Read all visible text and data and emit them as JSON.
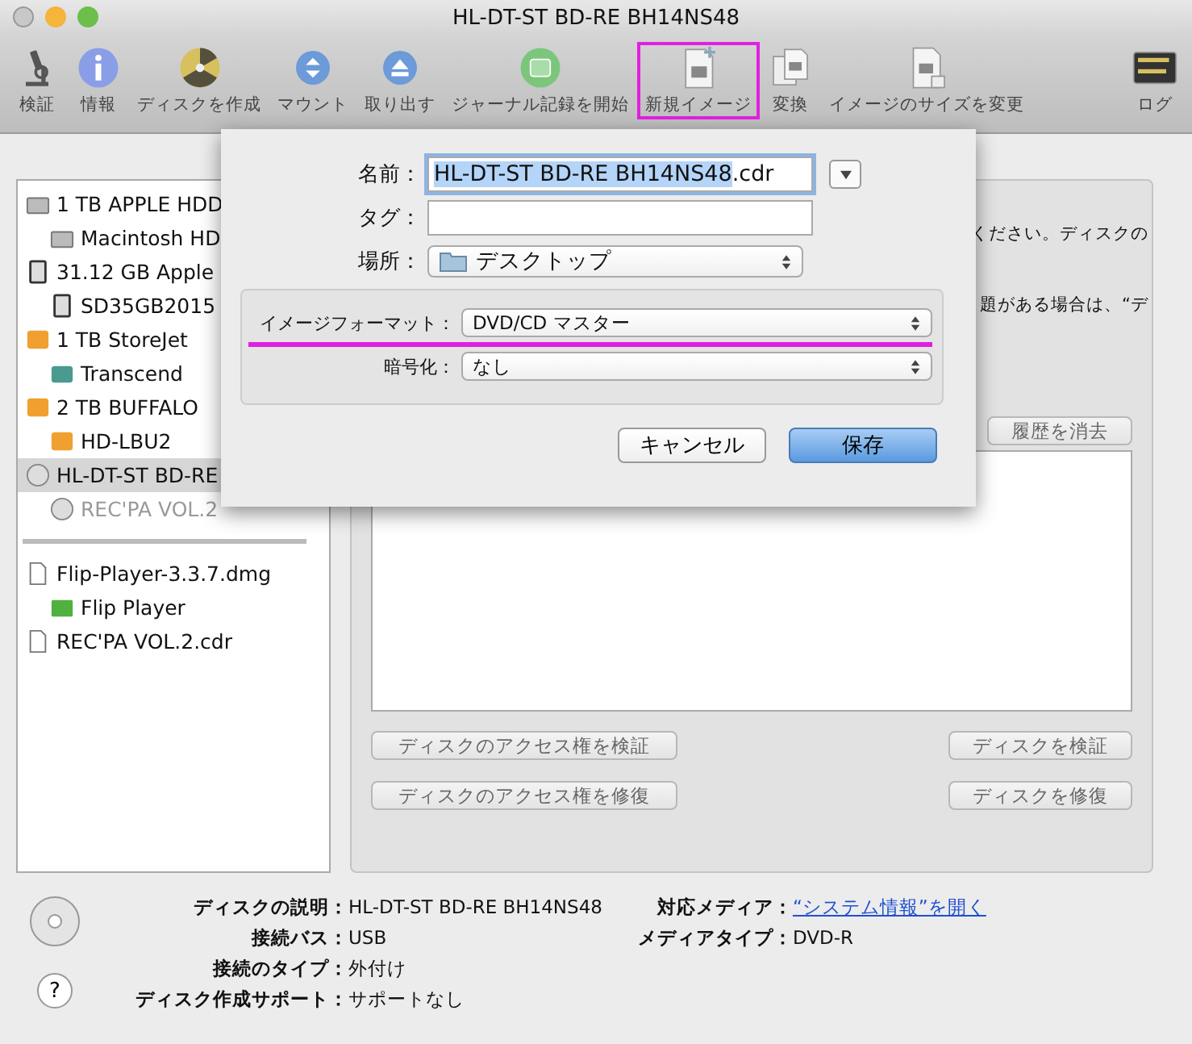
{
  "window": {
    "title": "HL-DT-ST BD-RE BH14NS48"
  },
  "toolbar": [
    {
      "kind": "microscope",
      "label": "検証",
      "highlighted": false
    },
    {
      "kind": "info",
      "label": "情報",
      "highlighted": false
    },
    {
      "kind": "burn",
      "label": "ディスクを作成",
      "highlighted": false
    },
    {
      "kind": "mount",
      "label": "マウント",
      "highlighted": false
    },
    {
      "kind": "eject",
      "label": "取り出す",
      "highlighted": false
    },
    {
      "kind": "journal",
      "label": "ジャーナル記録を開始",
      "highlighted": false
    },
    {
      "kind": "newimage",
      "label": "新規イメージ",
      "highlighted": true
    },
    {
      "kind": "convert",
      "label": "変換",
      "highlighted": false
    },
    {
      "kind": "resize",
      "label": "イメージのサイズを変更",
      "highlighted": false
    },
    {
      "kind": "log",
      "label": "ログ",
      "highlighted": false
    }
  ],
  "sidebar": {
    "groups": [
      [
        {
          "kind": "hdd",
          "name": "1 TB APPLE HDD",
          "selected": false,
          "disabled": false,
          "children": [
            {
              "kind": "hdd",
              "name": "Macintosh HD",
              "selected": false,
              "disabled": false
            }
          ]
        },
        {
          "kind": "sd",
          "name": "31.12 GB Apple",
          "selected": false,
          "disabled": false,
          "children": [
            {
              "kind": "sd",
              "name": "SD35GB2015",
              "selected": false,
              "disabled": false
            }
          ]
        },
        {
          "kind": "usb",
          "name": "1 TB StoreJet",
          "selected": false,
          "disabled": false,
          "children": [
            {
              "kind": "timemachine",
              "name": "Transcend",
              "selected": false,
              "disabled": false
            }
          ]
        },
        {
          "kind": "usb",
          "name": "2 TB BUFFALO",
          "selected": false,
          "disabled": false,
          "children": [
            {
              "kind": "usb",
              "name": "HD-LBU2",
              "selected": false,
              "disabled": false
            }
          ]
        },
        {
          "kind": "optical",
          "name": "HL-DT-ST BD-RE",
          "selected": true,
          "disabled": false,
          "children": [
            {
              "kind": "optical",
              "name": "REC'PA VOL.2",
              "selected": false,
              "disabled": true
            }
          ]
        }
      ],
      [
        {
          "kind": "dmg",
          "name": "Flip-Player-3.3.7.dmg",
          "selected": false,
          "disabled": false,
          "children": [
            {
              "kind": "volume",
              "name": "Flip Player",
              "selected": false,
              "disabled": false
            }
          ]
        },
        {
          "kind": "dmg",
          "name": "REC'PA VOL.2.cdr",
          "selected": false,
          "disabled": false
        }
      ]
    ]
  },
  "right_panel": {
    "texts": [
      "ください。ディスクの",
      "題がある場合は、“デ"
    ],
    "clear_history_button": "履歴を消去",
    "buttons_left": [
      "ディスクのアクセス権を検証",
      "ディスクのアクセス権を修復"
    ],
    "buttons_right": [
      "ディスクを検証",
      "ディスクを修復"
    ]
  },
  "sheet": {
    "name_label": "名前：",
    "name_selected": "HL-DT-ST BD-RE BH14NS48",
    "name_rest": ".cdr",
    "tag_label": "タグ：",
    "location_label": "場所：",
    "location_value": "デスクトップ",
    "options": [
      {
        "label": "イメージフォーマット：",
        "value": "DVD/CD マスター",
        "highlighted": true
      },
      {
        "label": "暗号化：",
        "value": "なし",
        "highlighted": false
      }
    ],
    "cancel_button": "キャンセル",
    "save_button": "保存"
  },
  "info": {
    "left": [
      {
        "label": "ディスクの説明：",
        "value": "HL-DT-ST BD-RE BH14NS48"
      },
      {
        "label": "接続バス：",
        "value": "USB"
      },
      {
        "label": "接続のタイプ：",
        "value": "外付け"
      },
      {
        "label": "ディスク作成サポート：",
        "value": "サポートなし"
      }
    ],
    "right": [
      {
        "label": "対応メディア：",
        "value": "“システム情報”を開く",
        "link": true
      },
      {
        "label": "メディアタイプ：",
        "value": "DVD-R",
        "link": false
      }
    ]
  },
  "help_button": "?"
}
